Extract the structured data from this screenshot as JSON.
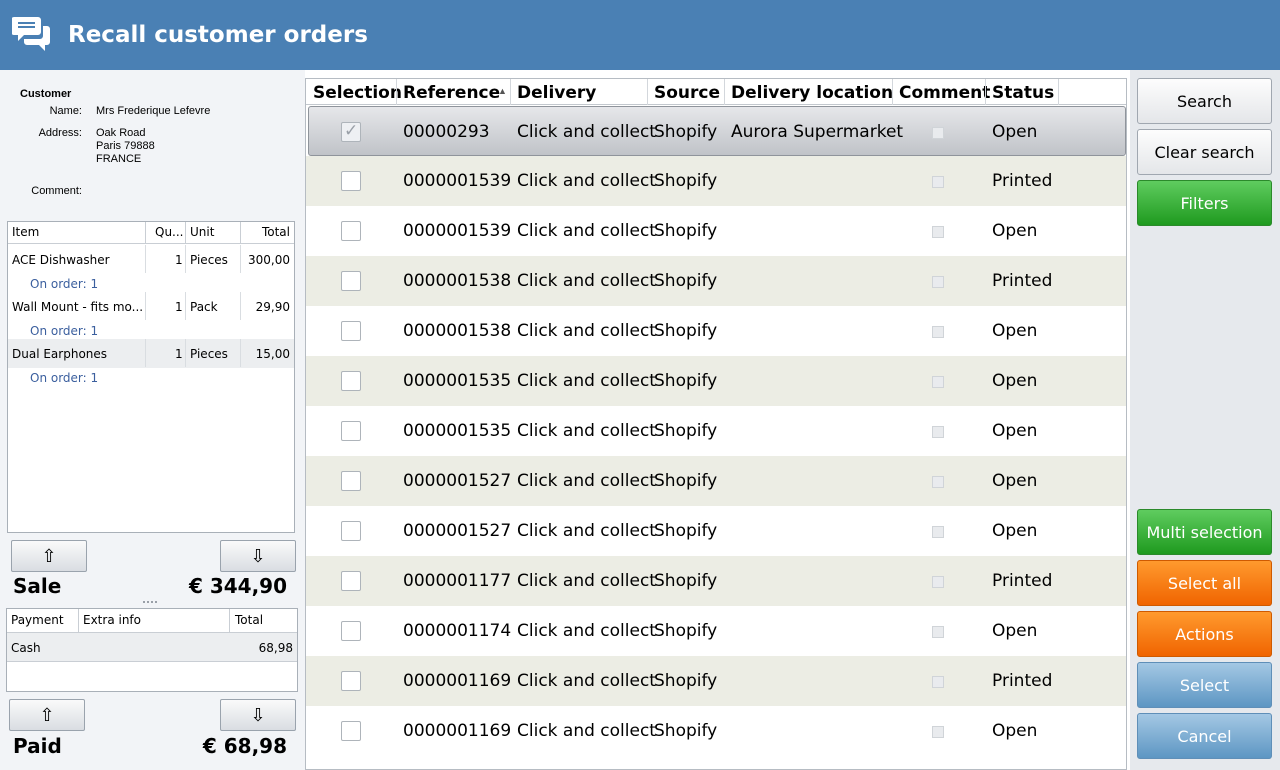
{
  "window": {
    "title": "Recall customer orders",
    "icon": "chat-bubbles-icon"
  },
  "customer": {
    "heading": "Customer",
    "name_label": "Name:",
    "name": "Mrs Frederique Lefevre",
    "address_label": "Address:",
    "address_line1": "Oak Road",
    "address_line2": "Paris 79888",
    "address_line3": "FRANCE",
    "comment_label": "Comment:"
  },
  "items": {
    "headers": {
      "item": "Item",
      "qty": "Qu...",
      "unit": "Unit",
      "total": "Total"
    },
    "rows": [
      {
        "item": "ACE Dishwasher",
        "qty": "1",
        "unit": "Pieces",
        "total": "300,00",
        "sub": "On order: 1"
      },
      {
        "item": "Wall Mount - fits mo...",
        "qty": "1",
        "unit": "Pack",
        "total": "29,90",
        "sub": "On order: 1"
      },
      {
        "item": "Dual Earphones",
        "qty": "1",
        "unit": "Pieces",
        "total": "15,00",
        "sub": "On order: 1"
      }
    ]
  },
  "sale": {
    "label": "Sale",
    "amount": "€ 344,90"
  },
  "payments": {
    "headers": {
      "payment": "Payment",
      "extra": "Extra info",
      "total": "Total"
    },
    "rows": [
      {
        "payment": "Cash",
        "extra": "",
        "total": "68,98"
      }
    ]
  },
  "paid": {
    "label": "Paid",
    "amount": "€ 68,98"
  },
  "grid": {
    "headers": {
      "selection": "Selection",
      "reference": "Reference",
      "delivery": "Delivery",
      "source": "Source",
      "location": "Delivery location",
      "comment": "Comment",
      "status": "Status"
    },
    "rows": [
      {
        "reference": "00000293",
        "delivery": "Click and collect",
        "source": "Shopify",
        "location": "Aurora Supermarket",
        "status": "Open",
        "selected": true
      },
      {
        "reference": "0000001539",
        "delivery": "Click and collect",
        "source": "Shopify",
        "location": "",
        "status": "Printed",
        "selected": false
      },
      {
        "reference": "0000001539",
        "delivery": "Click and collect",
        "source": "Shopify",
        "location": "",
        "status": "Open",
        "selected": false
      },
      {
        "reference": "0000001538",
        "delivery": "Click and collect",
        "source": "Shopify",
        "location": "",
        "status": "Printed",
        "selected": false
      },
      {
        "reference": "0000001538",
        "delivery": "Click and collect",
        "source": "Shopify",
        "location": "",
        "status": "Open",
        "selected": false
      },
      {
        "reference": "0000001535",
        "delivery": "Click and collect",
        "source": "Shopify",
        "location": "",
        "status": "Open",
        "selected": false
      },
      {
        "reference": "0000001535",
        "delivery": "Click and collect",
        "source": "Shopify",
        "location": "",
        "status": "Open",
        "selected": false
      },
      {
        "reference": "0000001527",
        "delivery": "Click and collect",
        "source": "Shopify",
        "location": "",
        "status": "Open",
        "selected": false
      },
      {
        "reference": "0000001527",
        "delivery": "Click and collect",
        "source": "Shopify",
        "location": "",
        "status": "Open",
        "selected": false
      },
      {
        "reference": "0000001177",
        "delivery": "Click and collect",
        "source": "Shopify",
        "location": "",
        "status": "Printed",
        "selected": false
      },
      {
        "reference": "0000001174",
        "delivery": "Click and collect",
        "source": "Shopify",
        "location": "",
        "status": "Open",
        "selected": false
      },
      {
        "reference": "0000001169",
        "delivery": "Click and collect",
        "source": "Shopify",
        "location": "",
        "status": "Printed",
        "selected": false
      },
      {
        "reference": "0000001169",
        "delivery": "Click and collect",
        "source": "Shopify",
        "location": "",
        "status": "Open",
        "selected": false
      }
    ]
  },
  "buttons": {
    "search": "Search",
    "clear_search": "Clear search",
    "filters": "Filters",
    "multi_selection": "Multi selection",
    "select_all": "Select all",
    "actions": "Actions",
    "select": "Select",
    "cancel": "Cancel"
  },
  "colors": {
    "title_bar": "#4a80b4",
    "green": "#2eaa2e",
    "orange": "#f77a10",
    "blue": "#7aaed6"
  }
}
